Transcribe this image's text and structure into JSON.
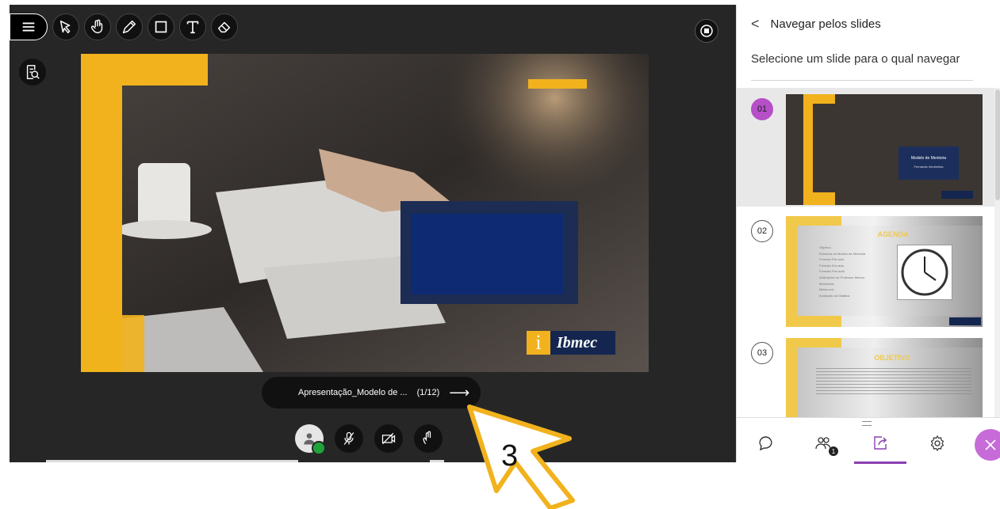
{
  "toolbar": {
    "icons": [
      "menu-icon",
      "pointer-icon",
      "hand-icon",
      "pen-icon",
      "rectangle-icon",
      "text-icon",
      "eraser-icon"
    ]
  },
  "slide": {
    "logo_text": "Ibmec",
    "logo_letter": "i"
  },
  "navigation": {
    "filename": "Apresentação_Modelo de ...",
    "counter": "(1/12)",
    "arrow": "⟶"
  },
  "panel": {
    "title": "Navegar pelos slides",
    "subtitle": "Selecione um slide para o qual navegar",
    "slides": [
      {
        "number": "01",
        "selected": true,
        "title": "Modelo de Mentoria",
        "subtitle": "Fernanda Inhofreitas"
      },
      {
        "number": "02",
        "selected": false,
        "title": "AGENDA",
        "items": [
          "Objetivo",
          "Estrutura do Modelo de Mentoria",
          "Formato Pré-aula",
          "Formato Em-aula",
          "Formato Pós-aula",
          "Atribuições do Professor Mentor",
          "Benefícios",
          "Metas nos",
          "Avaliação da Didática"
        ]
      },
      {
        "number": "03",
        "selected": false,
        "title": "OBJETIVO"
      }
    ],
    "tabs": [
      "chat-icon",
      "participants-icon",
      "share-content-icon",
      "settings-icon"
    ],
    "participants_badge": "1"
  },
  "annotation": {
    "label": "3"
  },
  "colors": {
    "stage_bg": "#262626",
    "accent_yellow": "#f1b21d",
    "selected_purple": "#b64fc8",
    "active_tab": "#8c3fb2",
    "navy": "#0e2a73"
  }
}
